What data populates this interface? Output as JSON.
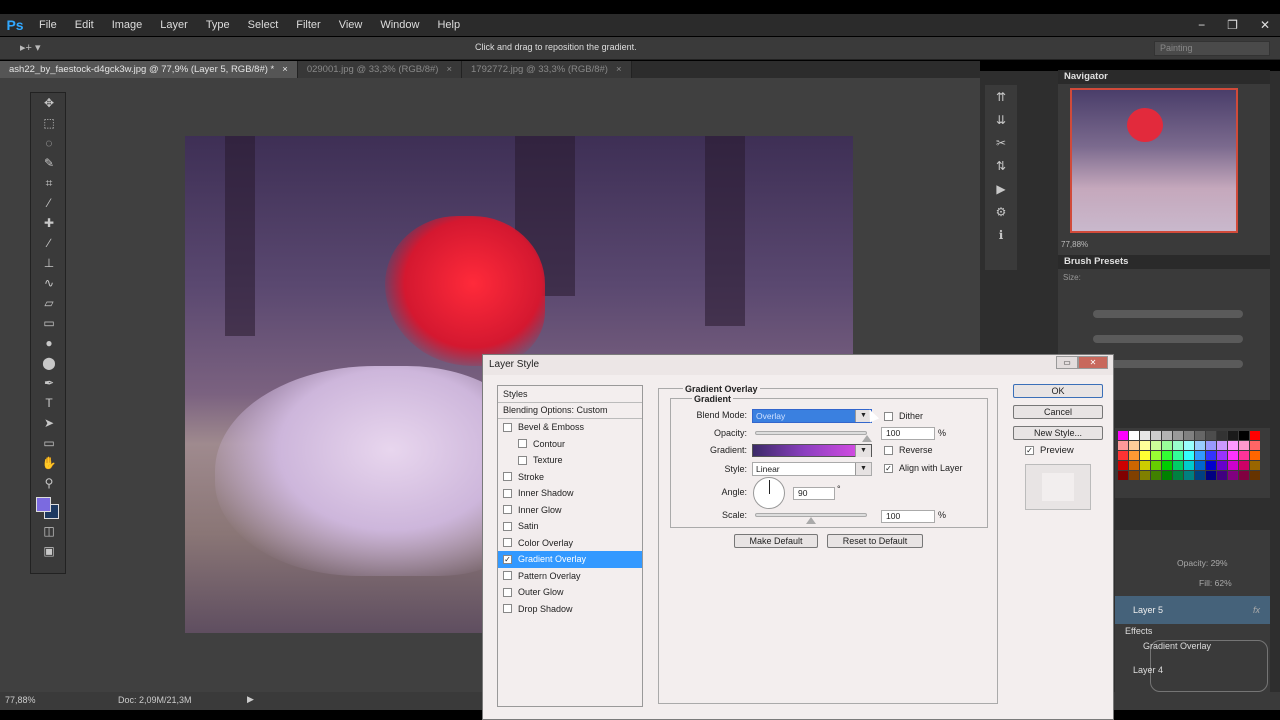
{
  "app": {
    "logo": "Ps",
    "menu": [
      "File",
      "Edit",
      "Image",
      "Layer",
      "Type",
      "Select",
      "Filter",
      "View",
      "Window",
      "Help"
    ]
  },
  "window_controls": {
    "minimize": "−",
    "restore": "❐",
    "close": "✕"
  },
  "options": {
    "hint": "Click and drag to reposition the gradient.",
    "workspace": "Painting",
    "tool_glyph": "▸+ ▾"
  },
  "tabs": [
    {
      "label": "ash22_by_faestock-d4gck3w.jpg @ 77,9% (Layer 5, RGB/8#) *",
      "close": "×"
    },
    {
      "label": "029001.jpg @ 33,3% (RGB/8#)",
      "close": "×"
    },
    {
      "label": "1792772.jpg @ 33,3% (RGB/8#)",
      "close": "×"
    }
  ],
  "tools": [
    {
      "name": "move-icon",
      "glyph": "✥"
    },
    {
      "name": "marquee-icon",
      "glyph": "⬚"
    },
    {
      "name": "lasso-icon",
      "glyph": "◌"
    },
    {
      "name": "quick-select-icon",
      "glyph": "✎"
    },
    {
      "name": "crop-icon",
      "glyph": "⌗"
    },
    {
      "name": "eyedropper-icon",
      "glyph": "⁄"
    },
    {
      "name": "healing-icon",
      "glyph": "✚"
    },
    {
      "name": "brush-icon",
      "glyph": "∕"
    },
    {
      "name": "stamp-icon",
      "glyph": "⊥"
    },
    {
      "name": "history-brush-icon",
      "glyph": "∿"
    },
    {
      "name": "eraser-icon",
      "glyph": "▱"
    },
    {
      "name": "gradient-tool-icon",
      "glyph": "▭"
    },
    {
      "name": "blur-icon",
      "glyph": "●"
    },
    {
      "name": "dodge-icon",
      "glyph": "⬤"
    },
    {
      "name": "pen-icon",
      "glyph": "✒"
    },
    {
      "name": "type-icon",
      "glyph": "T"
    },
    {
      "name": "path-select-icon",
      "glyph": "➤"
    },
    {
      "name": "shape-icon",
      "glyph": "▭"
    },
    {
      "name": "hand-icon",
      "glyph": "✋"
    },
    {
      "name": "zoom-icon",
      "glyph": "⚲"
    }
  ],
  "colors": {
    "foreground": "#7b6ae0",
    "background": "#1d3960",
    "accent": "#3399ff"
  },
  "icon_strip": [
    "⇈",
    "⇊",
    "✂",
    "⇅",
    "▶",
    "⚙",
    "ℹ"
  ],
  "navigator": {
    "title": "Navigator",
    "zoom": "77,88%"
  },
  "brush_presets": {
    "title": "Brush Presets",
    "size_label": "Size:"
  },
  "layers": {
    "opacity_label": "Opacity:",
    "opacity_value": "29%",
    "fill_label": "Fill:",
    "fill_value": "62%",
    "layer5": "Layer 5",
    "fx": "fx",
    "effects": "Effects",
    "effect_item": "Gradient Overlay",
    "layer4": "Layer 4"
  },
  "status": {
    "zoom": "77,88%",
    "doc": "Doc: 2,09M/21,3M",
    "arrow": "▶"
  },
  "dialog": {
    "title": "Layer Style",
    "winbtns": [
      "▭",
      "✕"
    ],
    "styles_header": "Styles",
    "blending_options": "Blending Options: Custom",
    "styles": [
      {
        "label": "Bevel & Emboss",
        "checked": false,
        "sub": false,
        "selected": false
      },
      {
        "label": "Contour",
        "checked": false,
        "sub": true,
        "selected": false
      },
      {
        "label": "Texture",
        "checked": false,
        "sub": true,
        "selected": false
      },
      {
        "label": "Stroke",
        "checked": false,
        "sub": false,
        "selected": false
      },
      {
        "label": "Inner Shadow",
        "checked": false,
        "sub": false,
        "selected": false
      },
      {
        "label": "Inner Glow",
        "checked": false,
        "sub": false,
        "selected": false
      },
      {
        "label": "Satin",
        "checked": false,
        "sub": false,
        "selected": false
      },
      {
        "label": "Color Overlay",
        "checked": false,
        "sub": false,
        "selected": false
      },
      {
        "label": "Gradient Overlay",
        "checked": true,
        "sub": false,
        "selected": true
      },
      {
        "label": "Pattern Overlay",
        "checked": false,
        "sub": false,
        "selected": false
      },
      {
        "label": "Outer Glow",
        "checked": false,
        "sub": false,
        "selected": false
      },
      {
        "label": "Drop Shadow",
        "checked": false,
        "sub": false,
        "selected": false
      }
    ],
    "group_title": "Gradient Overlay",
    "subgroup_title": "Gradient",
    "blend_mode_label": "Blend Mode:",
    "blend_mode_value": "Overlay",
    "opacity_label": "Opacity:",
    "opacity_value": "100",
    "opacity_fraction": 1.0,
    "percent": "%",
    "gradient_label": "Gradient:",
    "style_label": "Style:",
    "style_value": "Linear",
    "angle_label": "Angle:",
    "angle_value": "90",
    "degree": "°",
    "scale_label": "Scale:",
    "scale_value": "100",
    "scale_fraction": 0.5,
    "dither": {
      "label": "Dither",
      "checked": false
    },
    "reverse": {
      "label": "Reverse",
      "checked": false
    },
    "align": {
      "label": "Align with Layer",
      "checked": true
    },
    "make_default": "Make Default",
    "reset_default": "Reset to Default",
    "ok": "OK",
    "cancel": "Cancel",
    "new_style": "New Style...",
    "preview": {
      "label": "Preview",
      "checked": true
    },
    "arrow": "▼",
    "check": "✓"
  },
  "swatch_colors": [
    "#ff00ff",
    "#ffffff",
    "#e6e6e6",
    "#cccccc",
    "#b3b3b3",
    "#999999",
    "#808080",
    "#666666",
    "#4d4d4d",
    "#333333",
    "#1a1a1a",
    "#000000",
    "#ff0000",
    "#ff9999",
    "#ffcc99",
    "#ffff99",
    "#ccff99",
    "#99ff99",
    "#99ffcc",
    "#99ffff",
    "#99ccff",
    "#9999ff",
    "#cc99ff",
    "#ff99ff",
    "#ff99cc",
    "#ff6666",
    "#ff3333",
    "#ff9933",
    "#ffff33",
    "#99ff33",
    "#33ff33",
    "#33ff99",
    "#33ffff",
    "#3399ff",
    "#3333ff",
    "#9933ff",
    "#ff33ff",
    "#ff3399",
    "#ff6600",
    "#cc0000",
    "#cc6600",
    "#cccc00",
    "#66cc00",
    "#00cc00",
    "#00cc66",
    "#00cccc",
    "#0066cc",
    "#0000cc",
    "#6600cc",
    "#cc00cc",
    "#cc0066",
    "#996600",
    "#800000",
    "#804000",
    "#808000",
    "#408000",
    "#008000",
    "#008040",
    "#008080",
    "#004080",
    "#000080",
    "#400080",
    "#800080",
    "#800040",
    "#663300"
  ]
}
